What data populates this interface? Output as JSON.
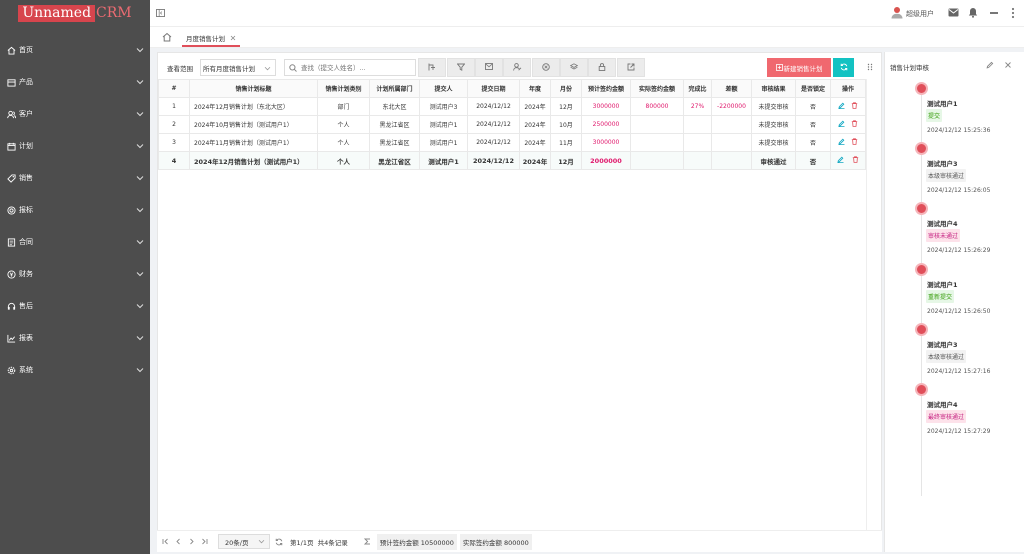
{
  "app": {
    "logo_main": "Unnamed",
    "logo_suffix": "CRM"
  },
  "sidebar": {
    "items": [
      {
        "label": "首页",
        "icon": "home-icon"
      },
      {
        "label": "产品",
        "icon": "box-icon"
      },
      {
        "label": "客户",
        "icon": "users-icon"
      },
      {
        "label": "计划",
        "icon": "calendar-icon"
      },
      {
        "label": "销售",
        "icon": "tag-icon"
      },
      {
        "label": "报标",
        "icon": "target-icon"
      },
      {
        "label": "合同",
        "icon": "document-icon"
      },
      {
        "label": "财务",
        "icon": "money-icon"
      },
      {
        "label": "售后",
        "icon": "headset-icon"
      },
      {
        "label": "报表",
        "icon": "chart-icon"
      },
      {
        "label": "系统",
        "icon": "settings-icon"
      }
    ]
  },
  "topbar": {
    "user": "超级用户"
  },
  "tabs": [
    {
      "label": "月度销售计划"
    }
  ],
  "toolbar": {
    "scope_label": "查看范围",
    "scope_value": "所有月度销售计划",
    "search_placeholder": "查找（提交人姓名）...",
    "new_button": "新建销售计划"
  },
  "table": {
    "headers": [
      "#",
      "销售计划标题",
      "销售计划类别",
      "计划所属部门",
      "提交人",
      "提交日期",
      "年度",
      "月份",
      "预计签约金额",
      "实际签约金额",
      "完成比",
      "差额",
      "审核结果",
      "是否锁定",
      "操作"
    ],
    "rows": [
      {
        "no": "1",
        "title": "2024年12月销售计划（东北大区）",
        "category": "部门",
        "dept": "东北大区",
        "submitter": "测试用户3",
        "date": "2024/12/12",
        "year": "2024年",
        "month": "12月",
        "expected": "3000000",
        "actual": "800000",
        "ratio": "27%",
        "diff": "-2200000",
        "result": "未提交审核",
        "locked": "否"
      },
      {
        "no": "2",
        "title": "2024年10月销售计划（测试用户1）",
        "category": "个人",
        "dept": "黑龙江省区",
        "submitter": "测试用户1",
        "date": "2024/12/12",
        "year": "2024年",
        "month": "10月",
        "expected": "2500000",
        "actual": "",
        "ratio": "",
        "diff": "",
        "result": "未提交审核",
        "locked": "否"
      },
      {
        "no": "3",
        "title": "2024年11月销售计划（测试用户1）",
        "category": "个人",
        "dept": "黑龙江省区",
        "submitter": "测试用户1",
        "date": "2024/12/12",
        "year": "2024年",
        "month": "11月",
        "expected": "3000000",
        "actual": "",
        "ratio": "",
        "diff": "",
        "result": "未提交审核",
        "locked": "否"
      },
      {
        "no": "4",
        "title": "2024年12月销售计划（测试用户1）",
        "category": "个人",
        "dept": "黑龙江省区",
        "submitter": "测试用户1",
        "date": "2024/12/12",
        "year": "2024年",
        "month": "12月",
        "expected": "2000000",
        "actual": "",
        "ratio": "",
        "diff": "",
        "result": "审核通过",
        "locked": "否"
      }
    ]
  },
  "footer": {
    "page_size": "20条/页",
    "page_info": "第1/1页  共4条记录",
    "sum_expected": "预计签约金额 10500000",
    "sum_actual": "实际签约金额 800000"
  },
  "panel": {
    "title": "销售计划审核",
    "entries": [
      {
        "user": "测试用户1",
        "status": "提交",
        "time": "2024/12/12 15:25:36",
        "tag_color": "#e6f7e6",
        "tag_text_color": "#389e0d"
      },
      {
        "user": "测试用户3",
        "status": "本级审核通过",
        "time": "2024/12/12 15:26:05",
        "tag_color": "#f2f2f2",
        "tag_text_color": "#555555"
      },
      {
        "user": "测试用户4",
        "status": "审核未通过",
        "time": "2024/12/12 15:26:29",
        "tag_color": "#fde2ea",
        "tag_text_color": "#c41d7f"
      },
      {
        "user": "测试用户1",
        "status": "重新提交",
        "time": "2024/12/12 15:26:50",
        "tag_color": "#e6f7e6",
        "tag_text_color": "#389e0d"
      },
      {
        "user": "测试用户3",
        "status": "本级审核通过",
        "time": "2024/12/12 15:27:16",
        "tag_color": "#f2f2f2",
        "tag_text_color": "#555555"
      },
      {
        "user": "测试用户4",
        "status": "最终审核通过",
        "time": "2024/12/12 15:27:29",
        "tag_color": "#fde2ea",
        "tag_text_color": "#c41d7f"
      }
    ]
  },
  "colors": {
    "accent": "#e04f5a",
    "teal": "#13c2c2",
    "sidebar": "#4d4d4d",
    "pink_value": "#e0186c"
  }
}
